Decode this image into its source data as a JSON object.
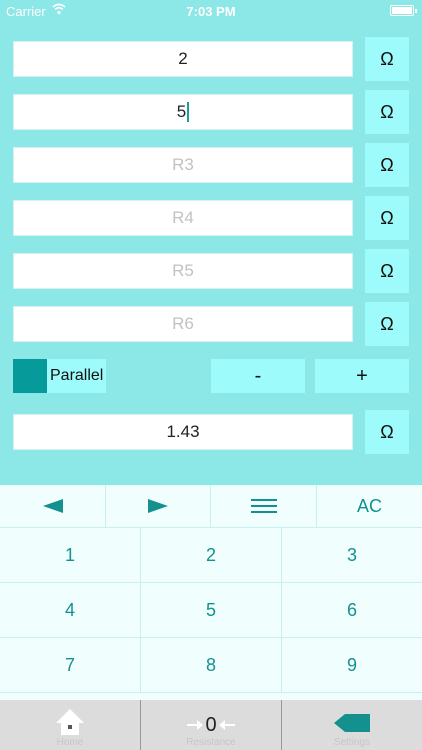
{
  "status_bar": {
    "carrier": "Carrier",
    "time": "7:03 PM",
    "battery_level": 1.0
  },
  "inputs": [
    {
      "value": "2",
      "placeholder": "R1",
      "unit": "Ω",
      "focused": false
    },
    {
      "value": "5",
      "placeholder": "R2",
      "unit": "Ω",
      "focused": true
    },
    {
      "value": "",
      "placeholder": "R3",
      "unit": "Ω",
      "focused": false
    },
    {
      "value": "",
      "placeholder": "R4",
      "unit": "Ω",
      "focused": false
    },
    {
      "value": "",
      "placeholder": "R5",
      "unit": "Ω",
      "focused": false
    },
    {
      "value": "",
      "placeholder": "R6",
      "unit": "Ω",
      "focused": false
    }
  ],
  "mode": {
    "label": "Parallel",
    "swatch_color": "#079a9a"
  },
  "controls": {
    "minus": "-",
    "plus": "+"
  },
  "result": {
    "value": "1.43",
    "unit": "Ω"
  },
  "keypad": {
    "top_row": {
      "left_icon": "left-arrow-icon",
      "right_icon": "right-arrow-icon",
      "menu_icon": "menu-icon",
      "clear": "AC"
    },
    "digits": [
      "1",
      "2",
      "3",
      "4",
      "5",
      "6",
      "7",
      "8",
      "9"
    ]
  },
  "tabbar": {
    "tabs": [
      {
        "label": "Home",
        "icon": "house-icon"
      },
      {
        "label": "Resistance",
        "icon": "resistor-icon",
        "icon_text": "0"
      },
      {
        "label": "Settings",
        "icon": "arrow-tag-icon"
      }
    ]
  },
  "colors": {
    "background": "#8ce7e7",
    "accent": "#14918f",
    "button": "#9efbfb"
  }
}
